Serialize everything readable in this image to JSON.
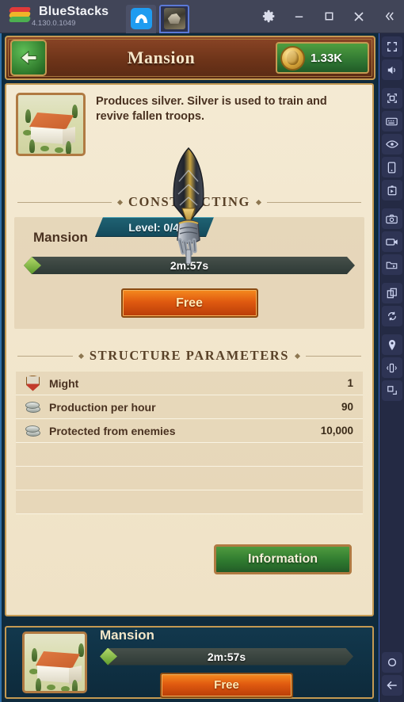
{
  "titlebar": {
    "app_name": "BlueStacks",
    "version": "4.130.0.1049",
    "tabs": [
      {
        "name": "home-tab",
        "icon": "home-icon",
        "active": false
      },
      {
        "name": "game-tab",
        "icon": "game-thumbnail-icon",
        "active": true
      }
    ],
    "controls": [
      {
        "name": "settings",
        "icon": "gear-icon"
      },
      {
        "name": "minimize",
        "icon": "minimize-icon"
      },
      {
        "name": "maximize",
        "icon": "maximize-icon"
      },
      {
        "name": "close",
        "icon": "close-icon"
      },
      {
        "name": "collapse",
        "icon": "double-chevron-left-icon"
      }
    ]
  },
  "sidebar": {
    "items": [
      {
        "icon": "fullscreen-icon"
      },
      {
        "icon": "volume-icon"
      },
      {
        "icon": "expand-arrows-icon"
      },
      {
        "icon": "keyboard-icon"
      },
      {
        "icon": "eye-icon"
      },
      {
        "icon": "tablet-icon"
      },
      {
        "icon": "macro-play-icon"
      },
      {
        "icon": "camera-icon"
      },
      {
        "icon": "video-recorder-icon"
      },
      {
        "icon": "media-folder-icon"
      },
      {
        "icon": "multi-instance-icon"
      },
      {
        "icon": "rotate-sync-icon"
      },
      {
        "icon": "location-pin-icon"
      },
      {
        "icon": "shake-device-icon"
      },
      {
        "icon": "window-layout-icon"
      },
      {
        "icon": "home-circle-icon"
      },
      {
        "icon": "back-arrow-icon"
      }
    ]
  },
  "game": {
    "header": {
      "back_icon": "back-arrow-icon",
      "title": "Mansion",
      "currency": {
        "icon": "gold-coin-icon",
        "value": "1.33K"
      }
    },
    "building": {
      "thumbnail_icon": "mansion-building-icon",
      "description": "Produces silver. Silver is used to train and revive fallen troops.",
      "level_label": "Level: 0/45"
    },
    "constructing": {
      "section_title": "Constructing",
      "name": "Mansion",
      "time_remaining": "2m:57s",
      "progress_percent": 1,
      "speedup_button": "Free"
    },
    "parameters": {
      "section_title": "Structure parameters",
      "rows": [
        {
          "icon": "might-shield-icon",
          "label": "Might",
          "value": "1"
        },
        {
          "icon": "silver-coins-icon",
          "label": "Production per hour",
          "value": "90"
        },
        {
          "icon": "silver-coins-icon",
          "label": "Protected from enemies",
          "value": "10,000"
        }
      ]
    },
    "information_button": "Information",
    "dock": {
      "thumbnail_icon": "mansion-building-icon",
      "name": "Mansion",
      "time_remaining": "2m:57s",
      "progress_percent": 1,
      "speedup_button": "Free"
    },
    "cursor_icon": "gauntlet-quill-cursor"
  },
  "colors": {
    "parchment": "#f2e6cc",
    "wood_frame": "#c59a52",
    "banner_brown": "#6e3419",
    "accent_green": "#2f7a2f",
    "accent_orange": "#e05a10",
    "teal_dock": "#0f2b3d",
    "bluestacks_bar": "#414558"
  }
}
